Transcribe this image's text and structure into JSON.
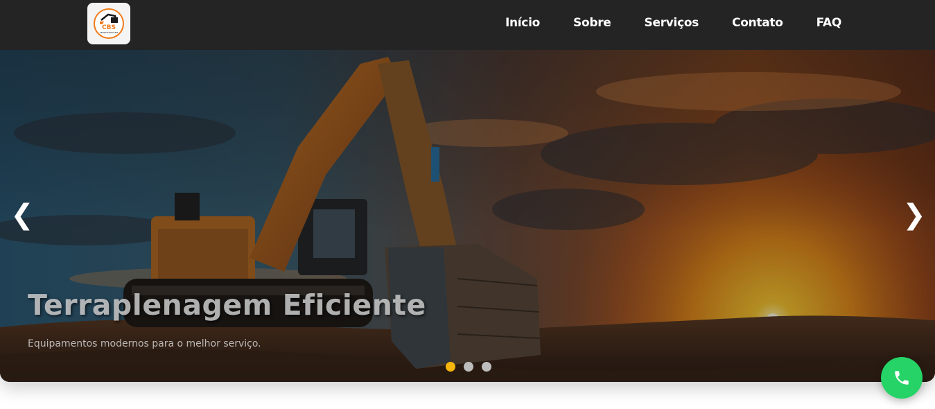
{
  "brand": {
    "logo_text": "CBS",
    "logo_subtext": "TERRAPLENAGEM",
    "logo_accent": "#f07a1a"
  },
  "nav": {
    "items": [
      {
        "label": "Início"
      },
      {
        "label": "Sobre"
      },
      {
        "label": "Serviços"
      },
      {
        "label": "Contato"
      },
      {
        "label": "FAQ"
      }
    ]
  },
  "hero": {
    "title": "Terraplenagem Eficiente",
    "subtitle": "Equipamentos modernos para o melhor serviço.",
    "prev_label": "❮",
    "next_label": "❯",
    "slides_count": 3,
    "active_slide": 1,
    "active_dot_color": "#f5b50a"
  },
  "whatsapp": {
    "icon": "whatsapp-icon",
    "color": "#25d366"
  }
}
